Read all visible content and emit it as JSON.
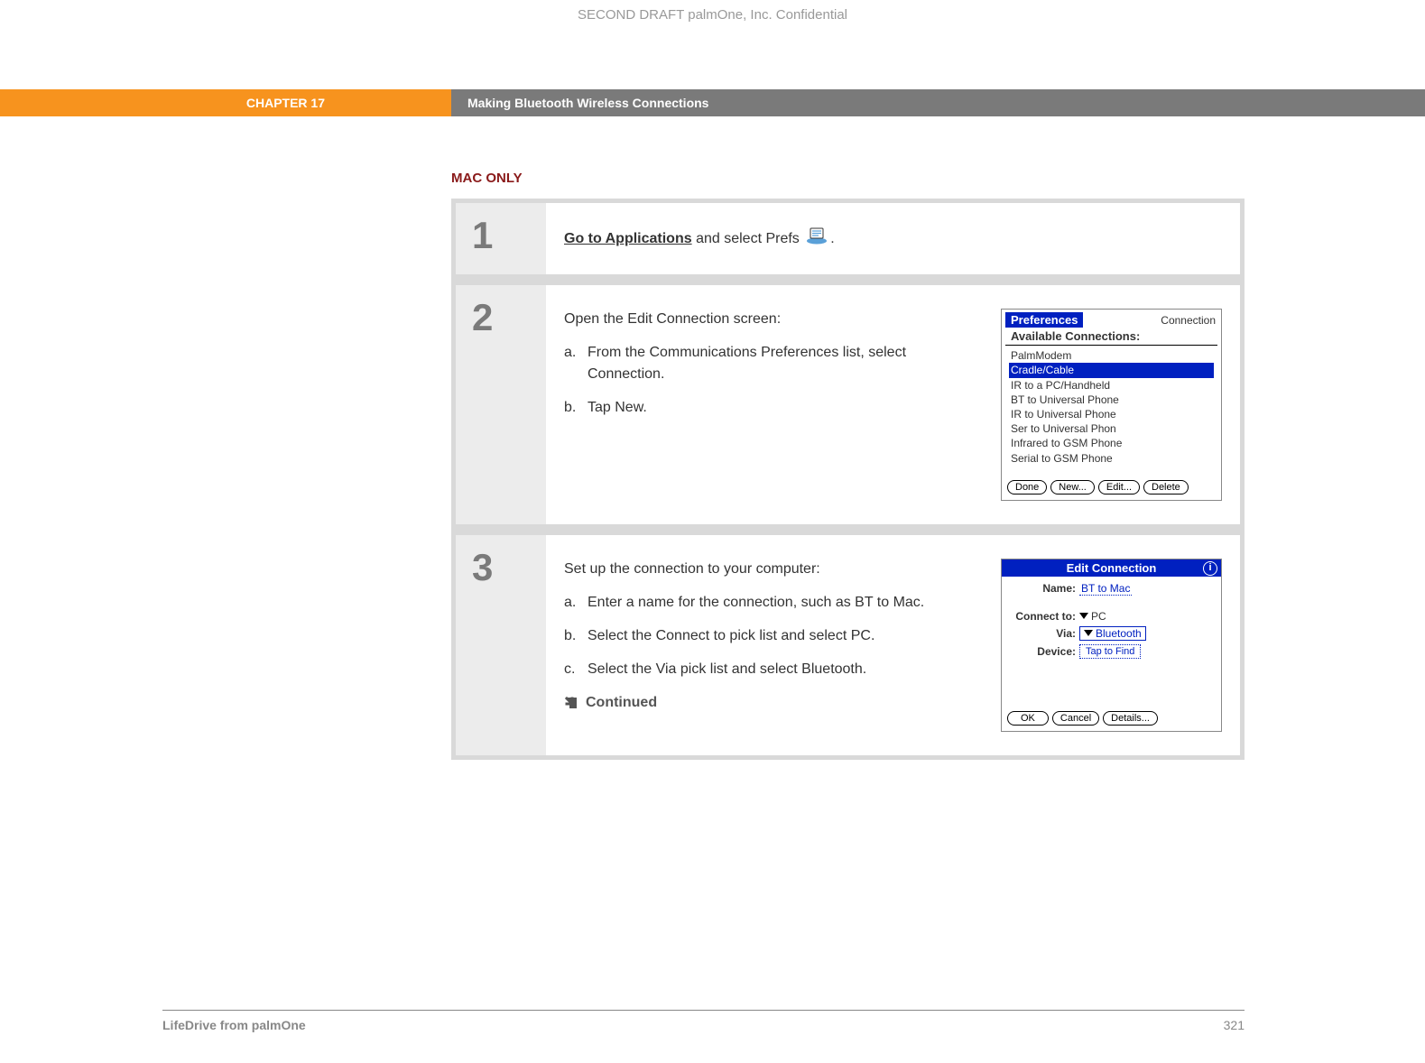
{
  "header": {
    "confidential": "SECOND DRAFT palmOne, Inc.  Confidential",
    "chapter_label": "CHAPTER 17",
    "chapter_title": "Making Bluetooth Wireless Connections"
  },
  "section_label": "MAC ONLY",
  "steps": {
    "s1": {
      "num": "1",
      "link_text": "Go to Applications",
      "tail_text": " and select Prefs ",
      "period": "."
    },
    "s2": {
      "num": "2",
      "lead": "Open the Edit Connection screen:",
      "a_letter": "a.",
      "a_text": "From the Communications Preferences list, select Connection.",
      "b_letter": "b.",
      "b_text": "Tap New."
    },
    "s3": {
      "num": "3",
      "lead": "Set up the connection to your computer:",
      "a_letter": "a.",
      "a_text": "Enter a name for the connection, such as BT to Mac.",
      "b_letter": "b.",
      "b_text": "Select the Connect to pick list and select PC.",
      "c_letter": "c.",
      "c_text": "Select the Via pick list and select Bluetooth.",
      "continued": "Continued"
    }
  },
  "palm1": {
    "title": "Preferences",
    "category": "Connection",
    "list_header": "Available Connections:",
    "items": {
      "i0": "PalmModem",
      "i1": "Cradle/Cable",
      "i2": "IR to a PC/Handheld",
      "i3": "BT to Universal Phone",
      "i4": "IR to Universal Phone",
      "i5": "Ser to Universal Phon",
      "i6": "Infrared to GSM Phone",
      "i7": "Serial to GSM Phone"
    },
    "btn_done": "Done",
    "btn_new": "New...",
    "btn_edit": "Edit...",
    "btn_delete": "Delete"
  },
  "palm2": {
    "title": "Edit Connection",
    "name_label": "Name:",
    "name_value": "BT to Mac",
    "connect_label": "Connect to:",
    "connect_value": "PC",
    "via_label": "Via:",
    "via_value": "Bluetooth",
    "device_label": "Device:",
    "device_value": "Tap to Find",
    "btn_ok": "OK",
    "btn_cancel": "Cancel",
    "btn_details": "Details..."
  },
  "footer": {
    "product": "LifeDrive from palmOne",
    "page": "321"
  }
}
